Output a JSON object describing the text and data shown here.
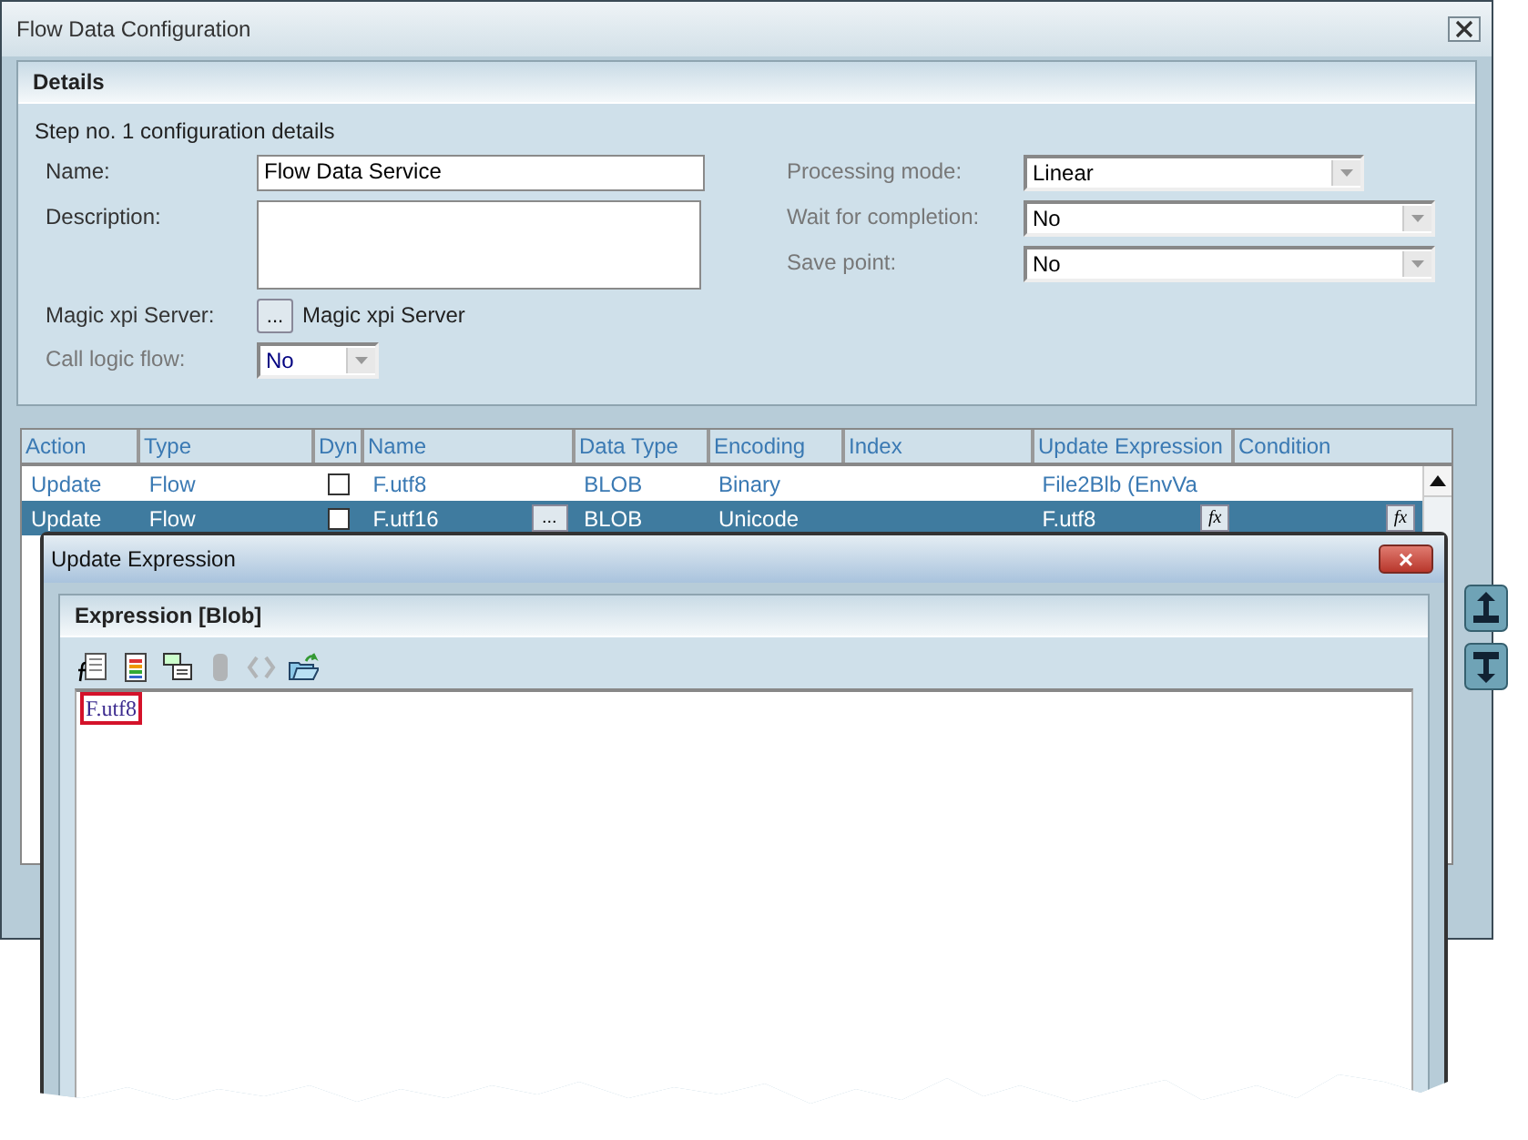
{
  "window": {
    "title": "Flow Data Configuration"
  },
  "details": {
    "heading": "Details",
    "step_text": "Step no. 1 configuration details",
    "left_fields": [
      {
        "kind": "text",
        "label": "Name:",
        "value": "Flow Data Service",
        "disabled": false
      },
      {
        "kind": "textarea",
        "label": "Description:",
        "disabled": false
      },
      {
        "kind": "browse",
        "label": "Magic xpi Server:",
        "browse_label": "...",
        "value": "Magic xpi Server",
        "disabled": false
      },
      {
        "kind": "dropdown",
        "label": "Call logic flow:",
        "value": "No",
        "disabled": true
      }
    ],
    "right_fields": [
      {
        "kind": "dropdown",
        "label": "Processing mode:",
        "value": "Linear",
        "disabled": true
      },
      {
        "kind": "dropdown",
        "label": "Wait for completion:",
        "value": "No",
        "disabled": true
      },
      {
        "kind": "dropdown",
        "label": "Save point:",
        "value": "No",
        "disabled": true
      }
    ]
  },
  "table": {
    "columns": [
      "Action",
      "Type",
      "Dyn",
      "Name",
      "Data Type",
      "Encoding",
      "Index",
      "Update Expression",
      "Condition"
    ],
    "rows": [
      {
        "selected": false,
        "action": "Update",
        "type": "Flow",
        "dyn_checked": false,
        "name": "F.utf8",
        "data_type": "BLOB",
        "encoding": "Binary",
        "index": "",
        "update_expression": "File2Blb (EnvVa"
      },
      {
        "selected": true,
        "action": "Update",
        "type": "Flow",
        "dyn_checked": false,
        "name": "F.utf16",
        "data_type": "BLOB",
        "encoding": "Unicode",
        "index": "",
        "update_expression": "F.utf8",
        "browse_label": "...",
        "update_fx_label": "fx",
        "condition_fx_label": "fx"
      }
    ]
  },
  "dialog": {
    "title": "Update Expression",
    "close_label": "×",
    "section": "Expression [Blob]",
    "toolbar": [
      {
        "kind": "function",
        "disabled": false
      },
      {
        "kind": "colors",
        "disabled": false
      },
      {
        "kind": "tree",
        "disabled": false
      },
      {
        "kind": "column",
        "disabled": true
      },
      {
        "kind": "brackets",
        "disabled": true
      },
      {
        "kind": "open",
        "disabled": false
      }
    ],
    "expression": {
      "text": "F.utf8",
      "highlighted": true
    }
  }
}
